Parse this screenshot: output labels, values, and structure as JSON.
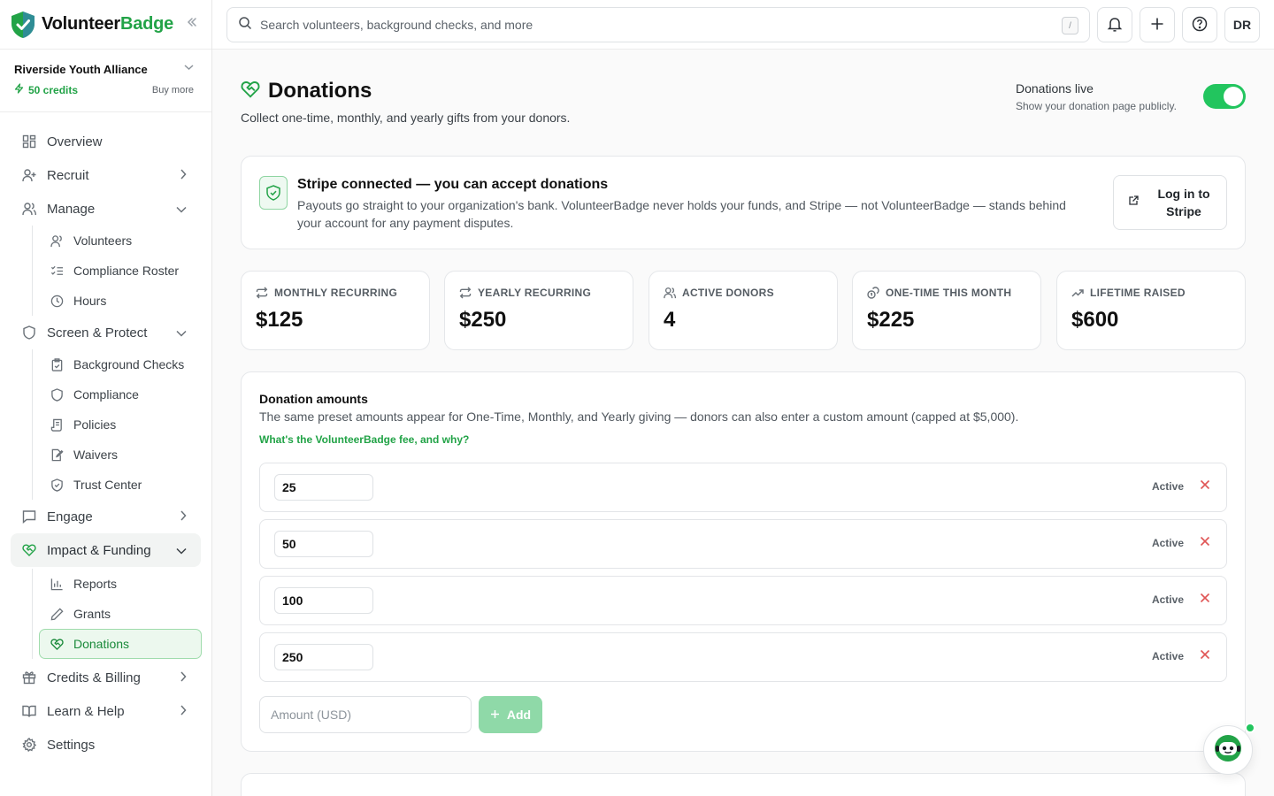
{
  "brand": {
    "name_part1": "Volunteer",
    "name_part2": "Badge"
  },
  "org": {
    "name": "Riverside Youth Alliance",
    "credits": "50 credits",
    "buy_more": "Buy more"
  },
  "nav": {
    "overview": "Overview",
    "recruit": "Recruit",
    "manage": "Manage",
    "manage_items": [
      "Volunteers",
      "Compliance Roster",
      "Hours"
    ],
    "screen": "Screen & Protect",
    "screen_items": [
      "Background Checks",
      "Compliance",
      "Policies",
      "Waivers",
      "Trust Center"
    ],
    "engage": "Engage",
    "impact": "Impact & Funding",
    "impact_items": [
      "Reports",
      "Grants",
      "Donations"
    ],
    "credits_billing": "Credits & Billing",
    "learn": "Learn & Help",
    "settings": "Settings"
  },
  "topbar": {
    "search_placeholder": "Search volunteers, background checks, and more",
    "shortcut": "/",
    "avatar": "DR"
  },
  "page": {
    "title": "Donations",
    "subtitle": "Collect one-time, monthly, and yearly gifts from your donors.",
    "live_title": "Donations live",
    "live_sub": "Show your donation page publicly.",
    "live_on": true
  },
  "stripe": {
    "title": "Stripe connected — you can accept donations",
    "body": "Payouts go straight to your organization's bank. VolunteerBadge never holds your funds, and Stripe — not VolunteerBadge — stands behind your account for any payment disputes.",
    "login": "Log in to Stripe"
  },
  "stats": [
    {
      "label": "MONTHLY RECURRING",
      "value": "$125",
      "icon": "repeat-icon"
    },
    {
      "label": "YEARLY RECURRING",
      "value": "$250",
      "icon": "repeat-icon"
    },
    {
      "label": "ACTIVE DONORS",
      "value": "4",
      "icon": "users-icon"
    },
    {
      "label": "ONE-TIME THIS MONTH",
      "value": "$225",
      "icon": "coins-icon"
    },
    {
      "label": "LIFETIME RAISED",
      "value": "$600",
      "icon": "trending-up-icon"
    }
  ],
  "amounts": {
    "title": "Donation amounts",
    "desc": "The same preset amounts appear for One-Time, Monthly, and Yearly giving — donors can also enter a custom amount (capped at $5,000).",
    "fee_link": "What's the VolunteerBadge fee, and why?",
    "rows": [
      {
        "value": "25",
        "status": "Active"
      },
      {
        "value": "50",
        "status": "Active"
      },
      {
        "value": "100",
        "status": "Active"
      },
      {
        "value": "250",
        "status": "Active"
      }
    ],
    "new_placeholder": "Amount (USD)",
    "add_label": "Add"
  },
  "colors": {
    "accent": "#22a347",
    "toggle": "#22c55e",
    "danger": "#e05555"
  }
}
